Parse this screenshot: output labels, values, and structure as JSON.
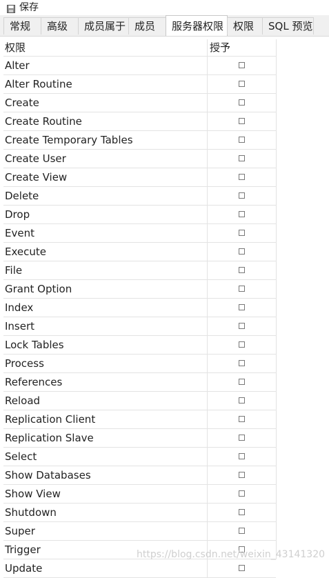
{
  "toolbar": {
    "save_label": "保存",
    "save_icon": "floppy-disk-icon"
  },
  "tabs": [
    {
      "label": "常规"
    },
    {
      "label": "高级"
    },
    {
      "label": "成员属于"
    },
    {
      "label": "成员"
    },
    {
      "label": "服务器权限",
      "active": true
    },
    {
      "label": "权限"
    },
    {
      "label": "SQL 预览"
    }
  ],
  "grid": {
    "columns": {
      "privilege": "权限",
      "grant": "授予"
    },
    "rows": [
      {
        "name": "Alter",
        "granted": false
      },
      {
        "name": "Alter Routine",
        "granted": false
      },
      {
        "name": "Create",
        "granted": false
      },
      {
        "name": "Create Routine",
        "granted": false
      },
      {
        "name": "Create Temporary Tables",
        "granted": false
      },
      {
        "name": "Create User",
        "granted": false
      },
      {
        "name": "Create View",
        "granted": false
      },
      {
        "name": "Delete",
        "granted": false
      },
      {
        "name": "Drop",
        "granted": false
      },
      {
        "name": "Event",
        "granted": false
      },
      {
        "name": "Execute",
        "granted": false
      },
      {
        "name": "File",
        "granted": false
      },
      {
        "name": "Grant Option",
        "granted": false
      },
      {
        "name": "Index",
        "granted": false
      },
      {
        "name": "Insert",
        "granted": false
      },
      {
        "name": "Lock Tables",
        "granted": false
      },
      {
        "name": "Process",
        "granted": false
      },
      {
        "name": "References",
        "granted": false
      },
      {
        "name": "Reload",
        "granted": false
      },
      {
        "name": "Replication Client",
        "granted": false
      },
      {
        "name": "Replication Slave",
        "granted": false
      },
      {
        "name": "Select",
        "granted": false
      },
      {
        "name": "Show Databases",
        "granted": false
      },
      {
        "name": "Show View",
        "granted": false
      },
      {
        "name": "Shutdown",
        "granted": false
      },
      {
        "name": "Super",
        "granted": false
      },
      {
        "name": "Trigger",
        "granted": false
      },
      {
        "name": "Update",
        "granted": false
      }
    ]
  },
  "watermark": "https://blog.csdn.net/weixin_43141320"
}
